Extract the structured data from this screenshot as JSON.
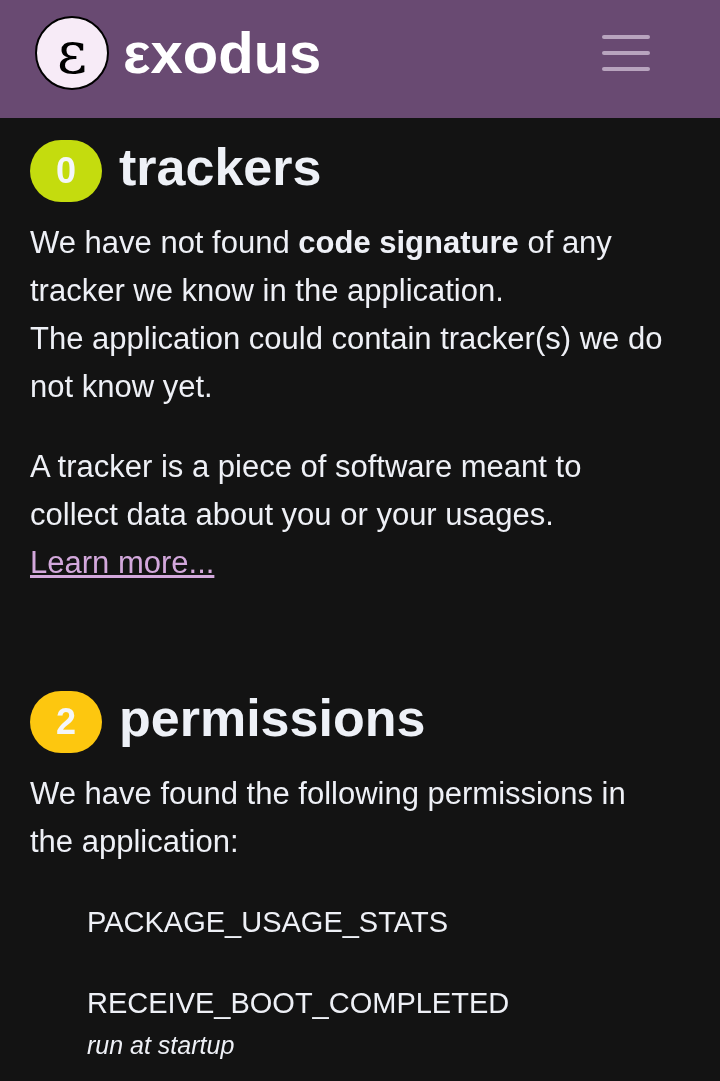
{
  "header": {
    "logo_glyph": "ε",
    "brand": "εxodus"
  },
  "sections": [
    {
      "count": "0",
      "color": "#c4dc0e",
      "title": "trackers",
      "paragraphs": [
        {
          "lines": [
            "We have not found **code signature** of any tracker we know in the application.",
            "The application could contain tracker(s) we do not know yet."
          ]
        },
        {
          "lines": [
            "A tracker is a piece of software meant to collect data about you or your usages."
          ],
          "link": "Learn more..."
        }
      ]
    },
    {
      "count": "2",
      "color": "#fdc70f",
      "title": "permissions",
      "paragraphs": [
        {
          "lines": [
            "We have found the following permissions in the application:"
          ]
        }
      ],
      "permissions": [
        {
          "name": "PACKAGE_USAGE_STATS"
        },
        {
          "name": "RECEIVE_BOOT_COMPLETED",
          "description": "run at startup"
        }
      ]
    }
  ]
}
